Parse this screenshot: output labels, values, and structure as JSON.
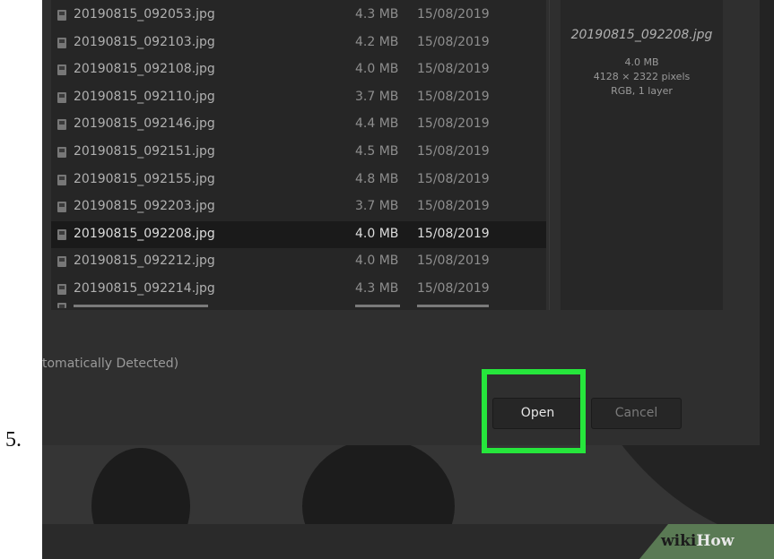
{
  "step_number": "5.",
  "files": [
    {
      "name": "20190815_092053.jpg",
      "size": "4.3 MB",
      "date": "15/08/2019"
    },
    {
      "name": "20190815_092103.jpg",
      "size": "4.2 MB",
      "date": "15/08/2019"
    },
    {
      "name": "20190815_092108.jpg",
      "size": "4.0 MB",
      "date": "15/08/2019"
    },
    {
      "name": "20190815_092110.jpg",
      "size": "3.7 MB",
      "date": "15/08/2019"
    },
    {
      "name": "20190815_092146.jpg",
      "size": "4.4 MB",
      "date": "15/08/2019"
    },
    {
      "name": "20190815_092151.jpg",
      "size": "4.5 MB",
      "date": "15/08/2019"
    },
    {
      "name": "20190815_092155.jpg",
      "size": "4.8 MB",
      "date": "15/08/2019"
    },
    {
      "name": "20190815_092203.jpg",
      "size": "3.7 MB",
      "date": "15/08/2019"
    },
    {
      "name": "20190815_092208.jpg",
      "size": "4.0 MB",
      "date": "15/08/2019",
      "selected": true
    },
    {
      "name": "20190815_092212.jpg",
      "size": "4.0 MB",
      "date": "15/08/2019"
    },
    {
      "name": "20190815_092214.jpg",
      "size": "4.3 MB",
      "date": "15/08/2019"
    }
  ],
  "preview": {
    "filename": "20190815_092208.jpg",
    "size": "4.0 MB",
    "dimensions": "4128 × 2322 pixels",
    "color_info": "RGB, 1 layer"
  },
  "file_type_label": "tomatically Detected)",
  "buttons": {
    "open": "Open",
    "cancel": "Cancel"
  },
  "highlight_color": "#26e63c",
  "watermark": {
    "wiki": "wiki",
    "how": "How"
  },
  "icons": {
    "file": "image-file-icon"
  }
}
